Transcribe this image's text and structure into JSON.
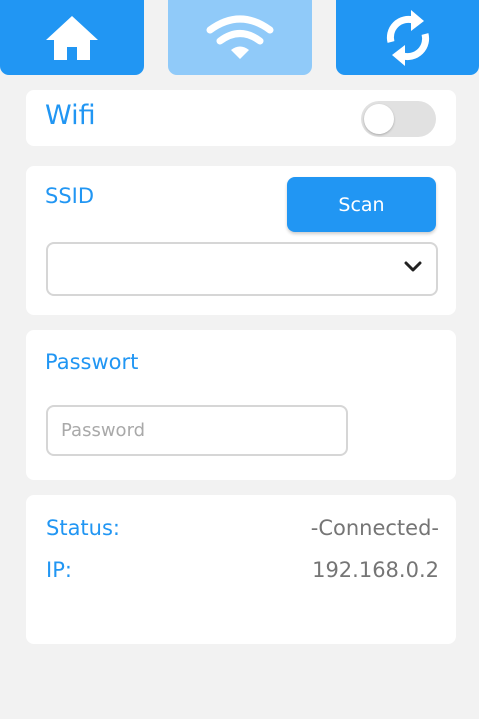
{
  "tabs": [
    {
      "name": "home",
      "icon": "home-icon"
    },
    {
      "name": "wifi",
      "icon": "wifi-icon",
      "active": true
    },
    {
      "name": "sync",
      "icon": "sync-icon"
    }
  ],
  "colors": {
    "accent": "#2196f3",
    "tab_active": "#90caf9",
    "background": "#f2f2f2",
    "card": "#ffffff",
    "value_text": "#757575"
  },
  "wifi": {
    "label": "Wifi",
    "enabled": false
  },
  "ssid": {
    "label": "SSID",
    "scan_label": "Scan",
    "selected": ""
  },
  "password": {
    "label": "Passwort",
    "placeholder": "Password",
    "value": ""
  },
  "status": {
    "status_label": "Status:",
    "status_value": "-Connected-",
    "ip_label": "IP:",
    "ip_value": "192.168.0.2"
  }
}
